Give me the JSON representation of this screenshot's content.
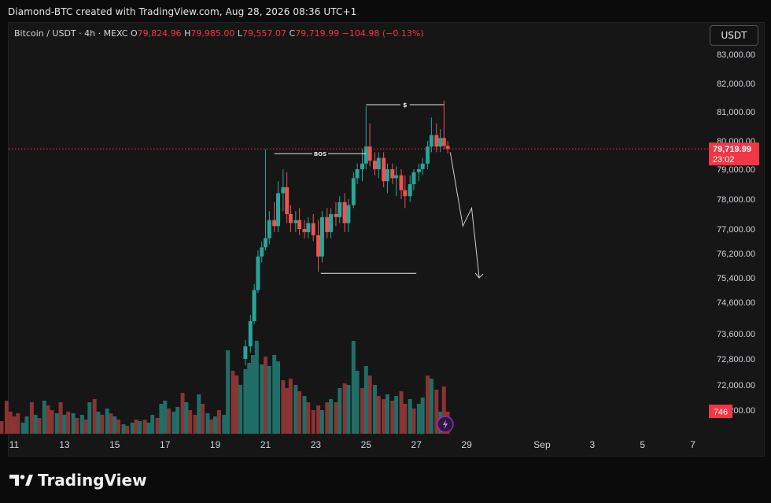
{
  "header": {
    "text": "Diamond-BTC created with TradingView.com, Aug 28, 2026 08:36 UTC+1"
  },
  "symbol": {
    "name": "Bitcoin / USDT · 4h · MEXC",
    "o_label": "O",
    "o_value": "79,824.96",
    "h_label": "H",
    "h_value": "79,985.00",
    "l_label": "L",
    "l_value": "79,557.07",
    "c_label": "C",
    "c_value": "79,719.99",
    "change": "−104.98 (−0.13%)"
  },
  "currency_button": "USDT",
  "footer": {
    "brand": "TradingView"
  },
  "colors": {
    "up": "#26a69a",
    "down": "#ef5350",
    "vol_up": "#1f6f68",
    "vol_down": "#8a3434",
    "price_tag": "#f23645"
  },
  "chart_data": {
    "type": "candlestick",
    "timeframe": "4h",
    "y_ticks": [
      83000,
      82000,
      81000,
      80000,
      79000,
      78000,
      77000,
      76200,
      75400,
      74600,
      73600,
      72800,
      72000,
      71200
    ],
    "y_tick_labels": [
      "83,000.00",
      "82,000.00",
      "81,000.00",
      "80,000.00",
      "79,000.00",
      "78,000.00",
      "77,000.00",
      "76,200.00",
      "75,400.00",
      "74,600.00",
      "73,600.00",
      "72,800.00",
      "72,000.00",
      "71,200.00"
    ],
    "x_labels": [
      {
        "label": "11",
        "day": 11
      },
      {
        "label": "13",
        "day": 13
      },
      {
        "label": "15",
        "day": 15
      },
      {
        "label": "17",
        "day": 17
      },
      {
        "label": "19",
        "day": 19
      },
      {
        "label": "21",
        "day": 21
      },
      {
        "label": "23",
        "day": 23
      },
      {
        "label": "25",
        "day": 25
      },
      {
        "label": "27",
        "day": 27
      },
      {
        "label": "29",
        "day": 29
      },
      {
        "label": "Sep",
        "day": 32
      },
      {
        "label": "3",
        "day": 34
      },
      {
        "label": "5",
        "day": 36
      },
      {
        "label": "7",
        "day": 38
      }
    ],
    "last_price": 79719.99,
    "last_price_label": "79,719.99",
    "countdown": "23:02",
    "volume_label": "746",
    "candles": [
      {
        "d": 20.2,
        "o": 72800,
        "h": 73400,
        "l": 72600,
        "c": 73200
      },
      {
        "d": 20.4,
        "o": 73200,
        "h": 74200,
        "l": 73000,
        "c": 74000
      },
      {
        "d": 20.55,
        "o": 74000,
        "h": 75200,
        "l": 73900,
        "c": 75000
      },
      {
        "d": 20.7,
        "o": 75000,
        "h": 76300,
        "l": 74900,
        "c": 76100
      },
      {
        "d": 20.85,
        "o": 76100,
        "h": 76600,
        "l": 75900,
        "c": 76400
      },
      {
        "d": 21.0,
        "o": 76400,
        "h": 79700,
        "l": 76300,
        "c": 76700
      },
      {
        "d": 21.15,
        "o": 76700,
        "h": 77600,
        "l": 76500,
        "c": 77300
      },
      {
        "d": 21.35,
        "o": 77300,
        "h": 77900,
        "l": 76900,
        "c": 77100
      },
      {
        "d": 21.5,
        "o": 77100,
        "h": 78600,
        "l": 76900,
        "c": 78200
      },
      {
        "d": 21.7,
        "o": 78200,
        "h": 79000,
        "l": 77600,
        "c": 78400
      },
      {
        "d": 21.85,
        "o": 78400,
        "h": 78900,
        "l": 77200,
        "c": 77500
      },
      {
        "d": 22.0,
        "o": 77500,
        "h": 77800,
        "l": 76900,
        "c": 77200
      },
      {
        "d": 22.2,
        "o": 77200,
        "h": 77600,
        "l": 76900,
        "c": 77300
      },
      {
        "d": 22.35,
        "o": 77300,
        "h": 77700,
        "l": 76800,
        "c": 77000
      },
      {
        "d": 22.55,
        "o": 77000,
        "h": 77300,
        "l": 76700,
        "c": 76900
      },
      {
        "d": 22.7,
        "o": 76900,
        "h": 77400,
        "l": 76700,
        "c": 77200
      },
      {
        "d": 22.9,
        "o": 77200,
        "h": 77500,
        "l": 76600,
        "c": 76800
      },
      {
        "d": 23.1,
        "o": 76800,
        "h": 77300,
        "l": 75600,
        "c": 76100
      },
      {
        "d": 23.25,
        "o": 76100,
        "h": 77600,
        "l": 75900,
        "c": 77400
      },
      {
        "d": 23.45,
        "o": 77400,
        "h": 77700,
        "l": 76700,
        "c": 76900
      },
      {
        "d": 23.6,
        "o": 76900,
        "h": 77700,
        "l": 76700,
        "c": 77500
      },
      {
        "d": 23.8,
        "o": 77500,
        "h": 77900,
        "l": 77100,
        "c": 77400
      },
      {
        "d": 23.95,
        "o": 77400,
        "h": 78100,
        "l": 77200,
        "c": 77900
      },
      {
        "d": 24.15,
        "o": 77900,
        "h": 78200,
        "l": 76900,
        "c": 77200
      },
      {
        "d": 24.3,
        "o": 77200,
        "h": 78000,
        "l": 76900,
        "c": 77800
      },
      {
        "d": 24.5,
        "o": 77800,
        "h": 78900,
        "l": 77700,
        "c": 78700
      },
      {
        "d": 24.65,
        "o": 78700,
        "h": 79200,
        "l": 78500,
        "c": 79000
      },
      {
        "d": 24.85,
        "o": 79000,
        "h": 79700,
        "l": 78600,
        "c": 79200
      },
      {
        "d": 25.0,
        "o": 79200,
        "h": 81200,
        "l": 79000,
        "c": 79800
      },
      {
        "d": 25.15,
        "o": 79800,
        "h": 80600,
        "l": 79100,
        "c": 79300
      },
      {
        "d": 25.35,
        "o": 79300,
        "h": 79600,
        "l": 78800,
        "c": 79000
      },
      {
        "d": 25.5,
        "o": 79000,
        "h": 79600,
        "l": 78700,
        "c": 79400
      },
      {
        "d": 25.7,
        "o": 79400,
        "h": 79600,
        "l": 78400,
        "c": 78600
      },
      {
        "d": 25.85,
        "o": 78600,
        "h": 79200,
        "l": 78200,
        "c": 79000
      },
      {
        "d": 26.05,
        "o": 79000,
        "h": 79200,
        "l": 78500,
        "c": 78700
      },
      {
        "d": 26.2,
        "o": 78700,
        "h": 79100,
        "l": 78100,
        "c": 78800
      },
      {
        "d": 26.4,
        "o": 78800,
        "h": 79000,
        "l": 78000,
        "c": 78300
      },
      {
        "d": 26.55,
        "o": 78300,
        "h": 78800,
        "l": 77700,
        "c": 78100
      },
      {
        "d": 26.75,
        "o": 78100,
        "h": 78800,
        "l": 77900,
        "c": 78500
      },
      {
        "d": 26.9,
        "o": 78500,
        "h": 79000,
        "l": 78300,
        "c": 78900
      },
      {
        "d": 27.1,
        "o": 78900,
        "h": 79200,
        "l": 78600,
        "c": 79000
      },
      {
        "d": 27.25,
        "o": 79000,
        "h": 79400,
        "l": 78800,
        "c": 79200
      },
      {
        "d": 27.45,
        "o": 79200,
        "h": 80000,
        "l": 79000,
        "c": 79800
      },
      {
        "d": 27.6,
        "o": 79800,
        "h": 80800,
        "l": 79600,
        "c": 80200
      },
      {
        "d": 27.8,
        "o": 80200,
        "h": 80600,
        "l": 79600,
        "c": 79800
      },
      {
        "d": 27.95,
        "o": 79800,
        "h": 80400,
        "l": 79600,
        "c": 80100
      },
      {
        "d": 28.1,
        "o": 80100,
        "h": 81400,
        "l": 79700,
        "c": 79825
      },
      {
        "d": 28.25,
        "o": 79825,
        "h": 79985,
        "l": 79557,
        "c": 79720
      }
    ],
    "volume": [
      {
        "d": 10.2,
        "v": 18,
        "up": true
      },
      {
        "d": 10.35,
        "v": 20,
        "up": true
      },
      {
        "d": 10.5,
        "v": 16,
        "up": false
      },
      {
        "d": 10.7,
        "v": 42,
        "up": false
      },
      {
        "d": 10.85,
        "v": 28,
        "up": false
      },
      {
        "d": 11.0,
        "v": 22,
        "up": false
      },
      {
        "d": 11.15,
        "v": 26,
        "up": false
      },
      {
        "d": 11.35,
        "v": 14,
        "up": true
      },
      {
        "d": 11.5,
        "v": 22,
        "up": true
      },
      {
        "d": 11.7,
        "v": 40,
        "up": false
      },
      {
        "d": 11.85,
        "v": 24,
        "up": true
      },
      {
        "d": 12.0,
        "v": 20,
        "up": false
      },
      {
        "d": 12.2,
        "v": 42,
        "up": true
      },
      {
        "d": 12.35,
        "v": 36,
        "up": false
      },
      {
        "d": 12.5,
        "v": 30,
        "up": false
      },
      {
        "d": 12.7,
        "v": 26,
        "up": true
      },
      {
        "d": 12.85,
        "v": 40,
        "up": false
      },
      {
        "d": 13.0,
        "v": 24,
        "up": true
      },
      {
        "d": 13.15,
        "v": 28,
        "up": false
      },
      {
        "d": 13.35,
        "v": 26,
        "up": true
      },
      {
        "d": 13.5,
        "v": 20,
        "up": false
      },
      {
        "d": 13.7,
        "v": 24,
        "up": true
      },
      {
        "d": 13.85,
        "v": 18,
        "up": false
      },
      {
        "d": 14.0,
        "v": 40,
        "up": true
      },
      {
        "d": 14.2,
        "v": 44,
        "up": false
      },
      {
        "d": 14.35,
        "v": 28,
        "up": true
      },
      {
        "d": 14.5,
        "v": 24,
        "up": false
      },
      {
        "d": 14.7,
        "v": 32,
        "up": true
      },
      {
        "d": 14.85,
        "v": 26,
        "up": false
      },
      {
        "d": 15.0,
        "v": 22,
        "up": true
      },
      {
        "d": 15.15,
        "v": 18,
        "up": false
      },
      {
        "d": 15.35,
        "v": 12,
        "up": true
      },
      {
        "d": 15.5,
        "v": 10,
        "up": false
      },
      {
        "d": 15.7,
        "v": 14,
        "up": true
      },
      {
        "d": 15.85,
        "v": 18,
        "up": false
      },
      {
        "d": 16.0,
        "v": 16,
        "up": true
      },
      {
        "d": 16.2,
        "v": 18,
        "up": false
      },
      {
        "d": 16.35,
        "v": 14,
        "up": true
      },
      {
        "d": 16.5,
        "v": 24,
        "up": true
      },
      {
        "d": 16.7,
        "v": 20,
        "up": false
      },
      {
        "d": 16.85,
        "v": 38,
        "up": true
      },
      {
        "d": 17.0,
        "v": 42,
        "up": true
      },
      {
        "d": 17.15,
        "v": 32,
        "up": false
      },
      {
        "d": 17.35,
        "v": 28,
        "up": true
      },
      {
        "d": 17.5,
        "v": 34,
        "up": true
      },
      {
        "d": 17.7,
        "v": 52,
        "up": false
      },
      {
        "d": 17.85,
        "v": 40,
        "up": true
      },
      {
        "d": 18.0,
        "v": 30,
        "up": false
      },
      {
        "d": 18.2,
        "v": 24,
        "up": false
      },
      {
        "d": 18.35,
        "v": 50,
        "up": true
      },
      {
        "d": 18.5,
        "v": 38,
        "up": false
      },
      {
        "d": 18.7,
        "v": 26,
        "up": true
      },
      {
        "d": 18.85,
        "v": 18,
        "up": false
      },
      {
        "d": 19.0,
        "v": 22,
        "up": true
      },
      {
        "d": 19.15,
        "v": 30,
        "up": false
      },
      {
        "d": 19.35,
        "v": 24,
        "up": true
      },
      {
        "d": 19.5,
        "v": 106,
        "up": true
      },
      {
        "d": 19.7,
        "v": 80,
        "up": false
      },
      {
        "d": 19.85,
        "v": 74,
        "up": false
      },
      {
        "d": 20.0,
        "v": 62,
        "up": true
      },
      {
        "d": 20.2,
        "v": 82,
        "up": true
      },
      {
        "d": 20.35,
        "v": 90,
        "up": true
      },
      {
        "d": 20.5,
        "v": 100,
        "up": true
      },
      {
        "d": 20.65,
        "v": 118,
        "up": true
      },
      {
        "d": 20.85,
        "v": 88,
        "up": true
      },
      {
        "d": 21.0,
        "v": 98,
        "up": false
      },
      {
        "d": 21.15,
        "v": 86,
        "up": true
      },
      {
        "d": 21.35,
        "v": 100,
        "up": true
      },
      {
        "d": 21.5,
        "v": 92,
        "up": true
      },
      {
        "d": 21.7,
        "v": 68,
        "up": false
      },
      {
        "d": 21.85,
        "v": 58,
        "up": false
      },
      {
        "d": 22.0,
        "v": 70,
        "up": false
      },
      {
        "d": 22.2,
        "v": 62,
        "up": true
      },
      {
        "d": 22.35,
        "v": 54,
        "up": false
      },
      {
        "d": 22.55,
        "v": 48,
        "up": true
      },
      {
        "d": 22.7,
        "v": 40,
        "up": false
      },
      {
        "d": 22.9,
        "v": 30,
        "up": false
      },
      {
        "d": 23.1,
        "v": 36,
        "up": false
      },
      {
        "d": 23.25,
        "v": 30,
        "up": true
      },
      {
        "d": 23.45,
        "v": 40,
        "up": false
      },
      {
        "d": 23.6,
        "v": 44,
        "up": true
      },
      {
        "d": 23.8,
        "v": 40,
        "up": false
      },
      {
        "d": 23.95,
        "v": 58,
        "up": true
      },
      {
        "d": 24.15,
        "v": 64,
        "up": false
      },
      {
        "d": 24.3,
        "v": 62,
        "up": true
      },
      {
        "d": 24.5,
        "v": 118,
        "up": true
      },
      {
        "d": 24.65,
        "v": 80,
        "up": true
      },
      {
        "d": 24.85,
        "v": 58,
        "up": false
      },
      {
        "d": 25.0,
        "v": 86,
        "up": true
      },
      {
        "d": 25.15,
        "v": 74,
        "up": false
      },
      {
        "d": 25.35,
        "v": 62,
        "up": true
      },
      {
        "d": 25.5,
        "v": 48,
        "up": false
      },
      {
        "d": 25.7,
        "v": 44,
        "up": false
      },
      {
        "d": 25.85,
        "v": 50,
        "up": true
      },
      {
        "d": 26.05,
        "v": 42,
        "up": false
      },
      {
        "d": 26.2,
        "v": 48,
        "up": true
      },
      {
        "d": 26.4,
        "v": 54,
        "up": false
      },
      {
        "d": 26.55,
        "v": 38,
        "up": false
      },
      {
        "d": 26.75,
        "v": 44,
        "up": true
      },
      {
        "d": 26.9,
        "v": 32,
        "up": false
      },
      {
        "d": 27.1,
        "v": 38,
        "up": true
      },
      {
        "d": 27.25,
        "v": 46,
        "up": true
      },
      {
        "d": 27.45,
        "v": 74,
        "up": false
      },
      {
        "d": 27.6,
        "v": 70,
        "up": true
      },
      {
        "d": 27.8,
        "v": 56,
        "up": false
      },
      {
        "d": 27.95,
        "v": 28,
        "up": true
      },
      {
        "d": 28.1,
        "v": 60,
        "up": false
      },
      {
        "d": 28.25,
        "v": 28,
        "up": false
      }
    ],
    "annotations": {
      "bos": {
        "label": "BOS",
        "price": 79550,
        "d_start": 21.35,
        "d_end": 25.0
      },
      "liquidity": {
        "label": "$",
        "price": 81250,
        "d_start": 25.0,
        "d_end": 28.1
      },
      "support": {
        "price": 75550,
        "d_start": 23.2,
        "d_end": 27.0
      },
      "projection": [
        {
          "d": 28.35,
          "p": 79600
        },
        {
          "d": 28.85,
          "p": 77100
        },
        {
          "d": 29.2,
          "p": 77700
        },
        {
          "d": 29.5,
          "p": 75400
        }
      ]
    }
  }
}
